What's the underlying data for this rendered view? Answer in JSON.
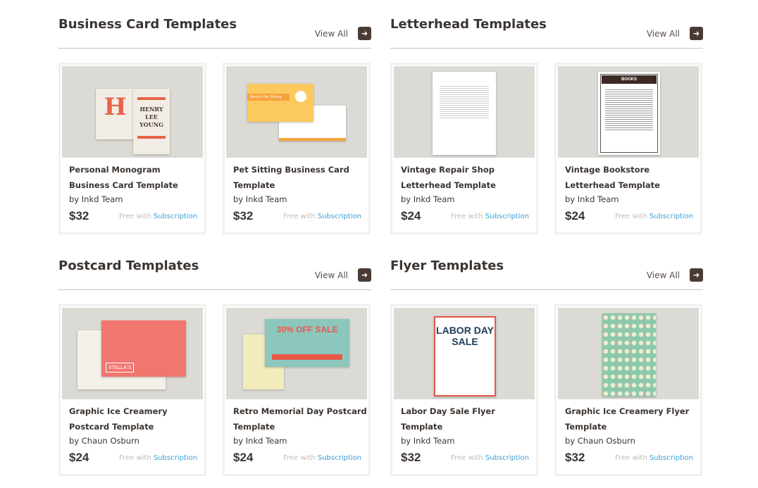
{
  "sections": [
    {
      "title": "Business Card Templates",
      "view_all": "View All",
      "cards": [
        {
          "title": "Personal Monogram Business Card Template",
          "author": "by Inkd Team",
          "price": "$32",
          "free": "Free with",
          "sub": "Subscription",
          "thumb_text": "HENRY LEE YOUNG"
        },
        {
          "title": "Pet Sitting Business Card Template",
          "author": "by Inkd Team",
          "price": "$32",
          "free": "Free with",
          "sub": "Subscription",
          "thumb_text": "Berty's Pet Sitting"
        }
      ]
    },
    {
      "title": "Letterhead Templates",
      "view_all": "View All",
      "cards": [
        {
          "title": "Vintage Repair Shop Letterhead Template",
          "author": "by Inkd Team",
          "price": "$24",
          "free": "Free with",
          "sub": "Subscription"
        },
        {
          "title": "Vintage Bookstore Letterhead Template",
          "author": "by Inkd Team",
          "price": "$24",
          "free": "Free with",
          "sub": "Subscription",
          "thumb_text": "BOOKS"
        }
      ]
    },
    {
      "title": "Postcard Templates",
      "view_all": "View All",
      "cards": [
        {
          "title": "Graphic Ice Creamery Postcard Template",
          "author": "by Chaun Osburn",
          "price": "$24",
          "free": "Free with",
          "sub": "Subscription",
          "thumb_text": "STELLA'S"
        },
        {
          "title": "Retro Memorial Day Postcard Template",
          "author": "by Inkd Team",
          "price": "$24",
          "free": "Free with",
          "sub": "Subscription",
          "thumb_text": "30% OFF SALE"
        }
      ]
    },
    {
      "title": "Flyer Templates",
      "view_all": "View All",
      "cards": [
        {
          "title": "Labor Day Sale Flyer Template",
          "author": "by Inkd Team",
          "price": "$32",
          "free": "Free with",
          "sub": "Subscription",
          "thumb_text": "LABOR DAY SALE"
        },
        {
          "title": "Graphic Ice Creamery Flyer Template",
          "author": "by Chaun Osburn",
          "price": "$32",
          "free": "Free with",
          "sub": "Subscription"
        }
      ]
    }
  ],
  "colors": {
    "accent_link": "#3a9fd6",
    "arrow_button": "#4a3c34",
    "heading": "#3b3430"
  }
}
